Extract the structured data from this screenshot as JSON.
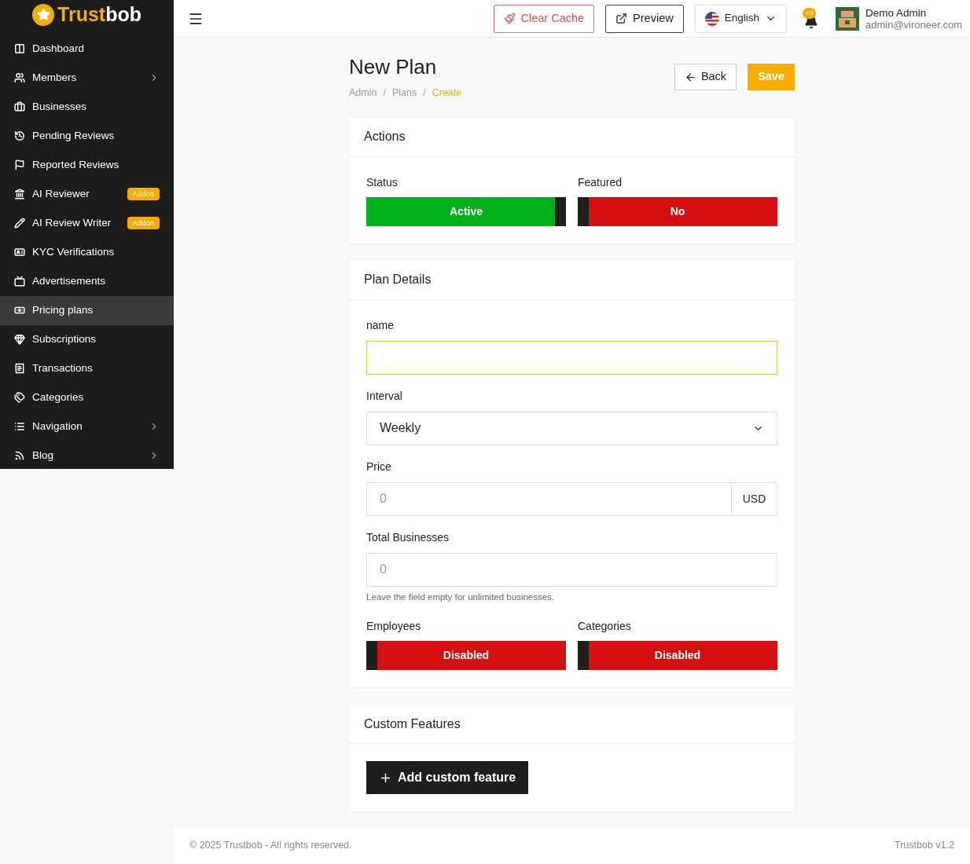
{
  "brand": {
    "name_first": "Trust",
    "name_second": "bob"
  },
  "sidebar": {
    "items": [
      {
        "label": "Dashboard",
        "selected": false,
        "has_submenu": false
      },
      {
        "label": "Members",
        "selected": false,
        "has_submenu": true
      },
      {
        "label": "Businesses",
        "selected": false,
        "has_submenu": false
      },
      {
        "label": "Pending Reviews",
        "selected": false,
        "has_submenu": false
      },
      {
        "label": "Reported Reviews",
        "selected": false,
        "has_submenu": false
      },
      {
        "label": "AI Reviewer",
        "selected": false,
        "has_submenu": false,
        "badge": "Addon"
      },
      {
        "label": "AI Review Writer",
        "selected": false,
        "has_submenu": false,
        "badge": "Addon"
      },
      {
        "label": "KYC Verifications",
        "selected": false,
        "has_submenu": false
      },
      {
        "label": "Advertisements",
        "selected": false,
        "has_submenu": false
      },
      {
        "label": "Pricing plans",
        "selected": true,
        "has_submenu": false
      },
      {
        "label": "Subscriptions",
        "selected": false,
        "has_submenu": false
      },
      {
        "label": "Transactions",
        "selected": false,
        "has_submenu": false
      },
      {
        "label": "Categories",
        "selected": false,
        "has_submenu": false
      },
      {
        "label": "Navigation",
        "selected": false,
        "has_submenu": true
      },
      {
        "label": "Blog",
        "selected": false,
        "has_submenu": true
      }
    ]
  },
  "header": {
    "clear_cache": "Clear Cache",
    "preview": "Preview",
    "language": "English",
    "notification_count": "+9",
    "user_name": "Demo Admin",
    "user_email": "admin@vironeer.com"
  },
  "page": {
    "title": "New Plan",
    "breadcrumb_separators": [
      "/",
      "/"
    ],
    "breadcrumbs": [
      {
        "label": "Admin",
        "selected": false
      },
      {
        "label": "Plans",
        "selected": false
      },
      {
        "label": "Create",
        "selected": true
      }
    ],
    "back": "Back",
    "save": "Save"
  },
  "actions_card": {
    "title": "Actions",
    "toggles": [
      {
        "label": "Status",
        "text": "Active",
        "on": true
      },
      {
        "label": "Featured",
        "text": "No",
        "on": false
      }
    ]
  },
  "plan_details": {
    "title": "Plan Details",
    "name": {
      "label": "name",
      "focused": true
    },
    "interval": {
      "label": "Interval",
      "value": "Weekly"
    },
    "price": {
      "label": "Price",
      "placeholder": "0",
      "addon": "USD"
    },
    "total_businesses": {
      "label": "Total Businesses",
      "placeholder": "0",
      "help": "Leave the field empty for unlimited businesses."
    },
    "toggles": [
      {
        "label": "Employees",
        "text": "Disabled",
        "on": false
      },
      {
        "label": "Categories",
        "text": "Disabled",
        "on": false
      }
    ]
  },
  "custom_features": {
    "title": "Custom Features",
    "add_button": "Add custom feature"
  },
  "footer": {
    "copyright": "© 2025 Trustbob - All rights reserved.",
    "version": "Trustbob v1.2"
  }
}
